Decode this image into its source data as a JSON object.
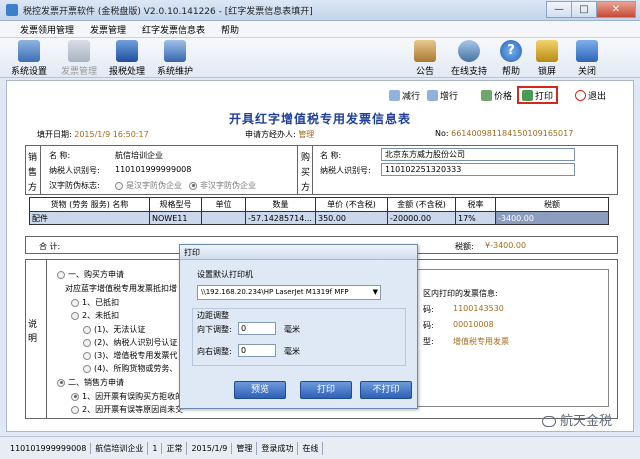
{
  "window": {
    "title": "税控发票开票软件 (金税盘版) V2.0.10.141226 - [红字发票信息表填开]",
    "min_label": "—",
    "max_label": "□",
    "close_label": "✕"
  },
  "menu": [
    "发票领用管理",
    "发票管理",
    "红字发票信息表",
    "帮助"
  ],
  "toolbar": {
    "left": [
      {
        "label": "系统设置",
        "icon": "settings-icon",
        "disabled": false
      },
      {
        "label": "发票管理",
        "icon": "invoice-icon",
        "disabled": true
      },
      {
        "label": "报税处理",
        "icon": "monitor-icon",
        "disabled": false
      },
      {
        "label": "系统维护",
        "icon": "maintenance-icon",
        "disabled": false
      }
    ],
    "right": [
      {
        "label": "公告",
        "icon": "clipboard-icon"
      },
      {
        "label": "在线支持",
        "icon": "support-icon"
      },
      {
        "label": "帮助",
        "icon": "help-icon"
      },
      {
        "label": "锁屏",
        "icon": "lock-icon"
      },
      {
        "label": "关闭",
        "icon": "close-arrow-icon"
      }
    ]
  },
  "doc_toolbar": {
    "decrease": "减行",
    "increase": "增行",
    "price": "价格",
    "print": "打印",
    "exit": "退出"
  },
  "form": {
    "title": "开具红字增值税专用发票信息表",
    "fill_date_label": "填开日期:",
    "fill_date": "2015/1/9 16:50:17",
    "applicant_label": "申请方经办人:",
    "applicant": "管理",
    "no_label": "No:",
    "no": "66140098118415010916501​7",
    "seller_side": [
      "销",
      "售",
      "方"
    ],
    "buyer_side": [
      "购",
      "买",
      "方"
    ],
    "seller": {
      "name_label": "名      称:",
      "name": "航信培训企业",
      "tax_id_label": "纳税人识别号:",
      "tax_id": "110101999999008",
      "anti_fake_label": "汉字防伪标志:",
      "option_yes": "是汉字防伪企业",
      "option_no": "非汉字防伪企业"
    },
    "buyer": {
      "name_label": "名      称:",
      "name": "北京东方威力股份公司",
      "tax_id_label": "纳税人识别号:",
      "tax_id": "110102251320333"
    },
    "table": {
      "headers": [
        "货物 (劳务 服务) 名称",
        "规格型号",
        "单位",
        "数量",
        "单价 (不含税)",
        "金额 (不含税)",
        "税率",
        "税额"
      ],
      "row": [
        "配件",
        "NOWE11",
        "",
        "-57.14285714...",
        "350.00",
        "-20000.00",
        "17%",
        "-3400.00"
      ]
    },
    "total_label": "合    计:",
    "tax_total_label": "税额:",
    "tax_total": "¥-3400.00",
    "remarks_side": "说\n明",
    "remarks": {
      "r1": "一、购买方申请",
      "r2": "对应蓝字增值税专用发票抵扣增",
      "r3": "1、已抵扣",
      "r4": "2、未抵扣",
      "r5": "(1)、无法认证",
      "r6": "(2)、纳税人识别号认证",
      "r7": "(3)、增值税专用发票代",
      "r8": "(4)、所购货物或劳务、",
      "r9": "二、销售方申请",
      "r10": "1、因开票有误购买方拒收的",
      "r11": "2、因开票有误等原因尚未交"
    },
    "right_remarks": {
      "title": "区内打印的发票信息:",
      "code_label": "码:",
      "code": "1100143530",
      "num_label": "码:",
      "num": "00010008",
      "type_label": "型:",
      "type": "增值税专用发票"
    }
  },
  "print_dialog": {
    "title": "打印",
    "printer_label": "设置默认打印机",
    "printer": "\\\\192.168.20.234\\HP LaserJet M1319f MFP",
    "margin_label": "边距调整",
    "down_label": "向下调整:",
    "down_value": "0",
    "right_label": "向右调整:",
    "right_value": "0",
    "unit": "毫米",
    "preview_btn": "预览",
    "print_btn": "打印",
    "noprint_btn": "不打印"
  },
  "status": [
    "110101999999008",
    "航信培训企业",
    "1",
    "正常",
    "2015/1/9",
    "管理",
    "登录成功",
    "在线"
  ],
  "watermark": "航天金税"
}
